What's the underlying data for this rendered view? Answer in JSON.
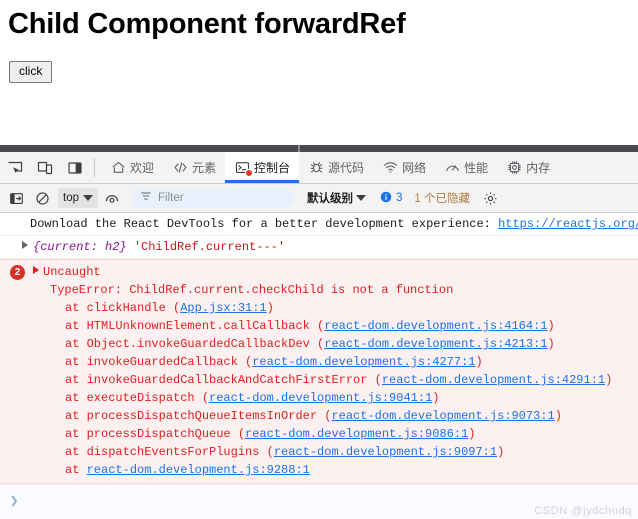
{
  "page": {
    "title": "Child Component forwardRef",
    "button_label": "click"
  },
  "devtools": {
    "tabs": [
      {
        "label": "欢迎",
        "icon": "home-icon",
        "active": false,
        "has_error": false
      },
      {
        "label": "元素",
        "icon": "code-icon",
        "active": false,
        "has_error": false
      },
      {
        "label": "控制台",
        "icon": "console-icon",
        "active": true,
        "has_error": true
      },
      {
        "label": "源代码",
        "icon": "bug-icon",
        "active": false,
        "has_error": false
      },
      {
        "label": "网络",
        "icon": "wifi-icon",
        "active": false,
        "has_error": false
      },
      {
        "label": "性能",
        "icon": "gauge-icon",
        "active": false,
        "has_error": false
      },
      {
        "label": "内存",
        "icon": "chip-icon",
        "active": false,
        "has_error": false
      }
    ],
    "toolbar": {
      "context_label": "top",
      "filter_placeholder": "Filter",
      "filter_value": "",
      "level_label": "默认级别",
      "issues_count": "3",
      "hidden_label": "1 个已隐藏"
    },
    "console": {
      "react_devtools_message": "Download the React DevTools for a better development experience: ",
      "react_devtools_link": "https://reactjs.org/link/re",
      "object_log": {
        "preview_open": "{",
        "preview_key": "current: ",
        "preview_value": "h2",
        "preview_close": "}",
        "string_arg": "'ChildRef.current---'"
      },
      "error": {
        "badge_count": "2",
        "headline": "Uncaught",
        "message": "TypeError: ChildRef.current.checkChild is not a function",
        "stack": [
          {
            "prefix": "at clickHandle (",
            "link": "App.jsx:31:1",
            "suffix": ")"
          },
          {
            "prefix": "at HTMLUnknownElement.callCallback (",
            "link": "react-dom.development.js:4164:1",
            "suffix": ")"
          },
          {
            "prefix": "at Object.invokeGuardedCallbackDev (",
            "link": "react-dom.development.js:4213:1",
            "suffix": ")"
          },
          {
            "prefix": "at invokeGuardedCallback (",
            "link": "react-dom.development.js:4277:1",
            "suffix": ")"
          },
          {
            "prefix": "at invokeGuardedCallbackAndCatchFirstError (",
            "link": "react-dom.development.js:4291:1",
            "suffix": ")"
          },
          {
            "prefix": "at executeDispatch (",
            "link": "react-dom.development.js:9041:1",
            "suffix": ")"
          },
          {
            "prefix": "at processDispatchQueueItemsInOrder (",
            "link": "react-dom.development.js:9073:1",
            "suffix": ")"
          },
          {
            "prefix": "at processDispatchQueue (",
            "link": "react-dom.development.js:9086:1",
            "suffix": ")"
          },
          {
            "prefix": "at dispatchEventsForPlugins (",
            "link": "react-dom.development.js:9097:1",
            "suffix": ")"
          },
          {
            "prefix": "at ",
            "link": "react-dom.development.js:9288:1",
            "suffix": ""
          }
        ]
      },
      "prompt_caret": "❯",
      "prompt_value": ""
    }
  },
  "watermark": "CSDN @jydchudq",
  "colors": {
    "accent": "#1a73e8",
    "error": "#e02020",
    "error_bg": "#fcf0f0",
    "error_badge": "#d93025",
    "toolbar_bg": "#f3f3f3",
    "splitter": "#4a4a4f",
    "string_literal": "#c41a16",
    "object_preview": "#881391"
  }
}
